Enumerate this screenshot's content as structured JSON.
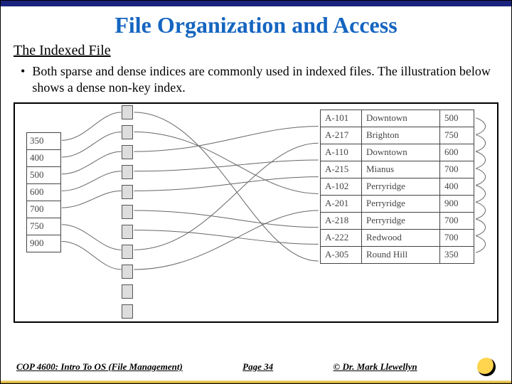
{
  "title": "File Organization and Access",
  "subtitle": "The Indexed File",
  "bullet_dot": "•",
  "bullet_text": "Both sparse and dense indices are commonly used in indexed files.  The illustration below shows a dense non-key index.",
  "index_values": [
    "350",
    "400",
    "500",
    "600",
    "700",
    "750",
    "900"
  ],
  "records": [
    {
      "acct": "A-101",
      "branch": "Downtown",
      "bal": "500"
    },
    {
      "acct": "A-217",
      "branch": "Brighton",
      "bal": "750"
    },
    {
      "acct": "A-110",
      "branch": "Downtown",
      "bal": "600"
    },
    {
      "acct": "A-215",
      "branch": "Mianus",
      "bal": "700"
    },
    {
      "acct": "A-102",
      "branch": "Perryridge",
      "bal": "400"
    },
    {
      "acct": "A-201",
      "branch": "Perryridge",
      "bal": "900"
    },
    {
      "acct": "A-218",
      "branch": "Perryridge",
      "bal": "700"
    },
    {
      "acct": "A-222",
      "branch": "Redwood",
      "bal": "700"
    },
    {
      "acct": "A-305",
      "branch": "Round Hill",
      "bal": "350"
    }
  ],
  "bucket_count": 11,
  "footer": {
    "course": "COP 4600: Intro To OS  (File Management)",
    "page": "Page 34",
    "author": "© Dr. Mark Llewellyn"
  }
}
